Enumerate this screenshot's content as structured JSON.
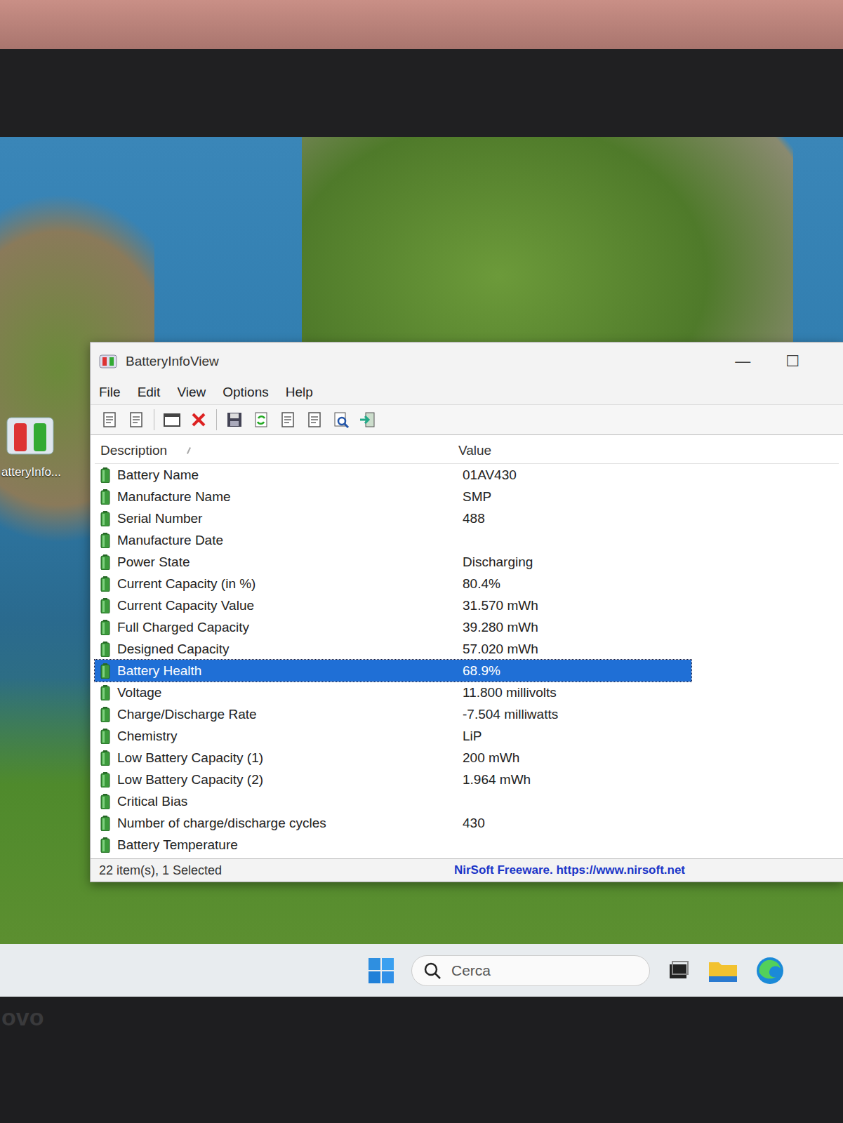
{
  "desktop": {
    "icon_label": "atteryInfo..."
  },
  "window": {
    "title": "BatteryInfoView",
    "controls": [
      "—",
      "☐"
    ]
  },
  "menu": [
    "File",
    "Edit",
    "View",
    "Options",
    "Help"
  ],
  "table": {
    "columns": [
      "Description",
      "Value"
    ],
    "rows": [
      {
        "description": "Battery Name",
        "value": "01AV430",
        "selected": false
      },
      {
        "description": "Manufacture Name",
        "value": "SMP",
        "selected": false
      },
      {
        "description": "Serial Number",
        "value": "488",
        "selected": false
      },
      {
        "description": "Manufacture Date",
        "value": "",
        "selected": false
      },
      {
        "description": "Power State",
        "value": "Discharging",
        "selected": false
      },
      {
        "description": "Current Capacity (in %)",
        "value": "80.4%",
        "selected": false
      },
      {
        "description": "Current Capacity Value",
        "value": "31.570 mWh",
        "selected": false
      },
      {
        "description": "Full Charged Capacity",
        "value": "39.280 mWh",
        "selected": false
      },
      {
        "description": "Designed Capacity",
        "value": "57.020 mWh",
        "selected": false
      },
      {
        "description": "Battery Health",
        "value": "68.9%",
        "selected": true
      },
      {
        "description": "Voltage",
        "value": "11.800 millivolts",
        "selected": false
      },
      {
        "description": "Charge/Discharge Rate",
        "value": "-7.504 milliwatts",
        "selected": false
      },
      {
        "description": "Chemistry",
        "value": "LiP",
        "selected": false
      },
      {
        "description": "Low Battery Capacity (1)",
        "value": "200 mWh",
        "selected": false
      },
      {
        "description": "Low Battery Capacity (2)",
        "value": "1.964 mWh",
        "selected": false
      },
      {
        "description": "Critical Bias",
        "value": "",
        "selected": false
      },
      {
        "description": "Number of charge/discharge cycles",
        "value": "430",
        "selected": false
      },
      {
        "description": "Battery Temperature",
        "value": "",
        "selected": false
      }
    ]
  },
  "status_bar": {
    "count": "22 item(s), 1 Selected",
    "credit": "NirSoft Freeware. https://www.nirsoft.net"
  },
  "taskbar": {
    "search_placeholder": "Cerca"
  },
  "bezel": {
    "logo": "ovo"
  }
}
